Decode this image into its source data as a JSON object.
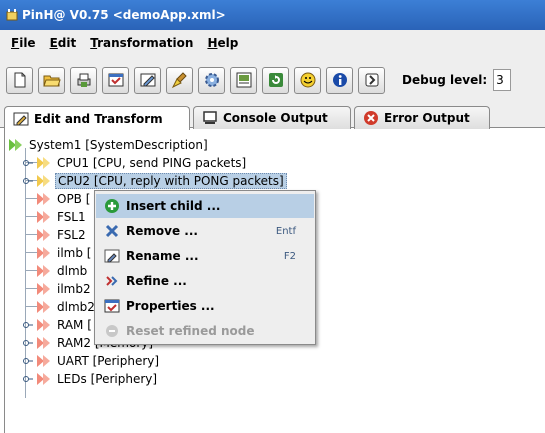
{
  "window": {
    "title": "PinH@ V0.75 <demoApp.xml>"
  },
  "menu": [
    {
      "label": "File",
      "mnemonic": "F",
      "rest": "ile"
    },
    {
      "label": "Edit",
      "mnemonic": "E",
      "rest": "dit"
    },
    {
      "label": "Transformation",
      "mnemonic": "T",
      "rest": "ransformation"
    },
    {
      "label": "Help",
      "mnemonic": "H",
      "rest": "elp"
    }
  ],
  "toolbar": {
    "buttons": [
      "new-file-icon",
      "open-folder-icon",
      "print-icon",
      "properties-icon",
      "edit-icon",
      "clean-icon",
      "settings-icon",
      "view-icon",
      "refresh-icon",
      "smiley-icon",
      "info-icon",
      "exit-icon"
    ],
    "debug_label": "Debug level:",
    "debug_value": "3"
  },
  "tabs": [
    {
      "label": "Edit and Transform",
      "icon": "edit-tab-icon",
      "active": true
    },
    {
      "label": "Console Output",
      "icon": "monitor-icon",
      "active": false
    },
    {
      "label": "Error Output",
      "icon": "error-icon",
      "active": false
    }
  ],
  "tree": {
    "root": "System1 [SystemDescription]",
    "nodes": [
      "CPU1 [CPU, send PING packets]",
      "CPU2 [CPU, reply with PONG packets]",
      "OPB [",
      "FSL1",
      "FSL2",
      "ilmb [",
      "dlmb",
      "ilmb2",
      "dlmb2",
      "RAM [",
      "RAM2 [Memory]",
      "UART [Periphery]",
      "LEDs [Periphery]"
    ]
  },
  "context_menu": {
    "items": [
      {
        "label": "Insert child ...",
        "icon": "add-icon",
        "shortcut": "",
        "enabled": true,
        "highlighted": true
      },
      {
        "label": "Remove ...",
        "icon": "remove-icon",
        "shortcut": "Entf",
        "enabled": true,
        "highlighted": false
      },
      {
        "label": "Rename ...",
        "icon": "rename-icon",
        "shortcut": "F2",
        "enabled": true,
        "highlighted": false
      },
      {
        "label": "Refine ...",
        "icon": "refine-icon",
        "shortcut": "",
        "enabled": true,
        "highlighted": false
      },
      {
        "label": "Properties ...",
        "icon": "properties-icon",
        "shortcut": "",
        "enabled": true,
        "highlighted": false
      },
      {
        "label": "Reset refined node",
        "icon": "reset-icon",
        "shortcut": "",
        "enabled": false,
        "highlighted": false
      }
    ]
  },
  "colors": {
    "titlebar": "#2a63b8",
    "selection": "#b8cfe5",
    "node_icon": "#f2c94c"
  }
}
